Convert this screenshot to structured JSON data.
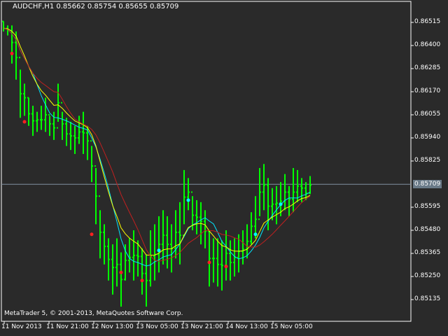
{
  "header": {
    "title": "AUDCHF,H1  0.85662 0.85754 0.85655 0.85709"
  },
  "footer": {
    "copyright": "MetaTrader 5, © 2001-2013, MetaQuotes Software Corp."
  },
  "colors": {
    "bg": "#2a2a2a",
    "bars": "#00ff00",
    "ma_fast": "#00e5ff",
    "ma_slow": "#ffff00",
    "ma_signal": "#c02020",
    "frame": "#ffffff",
    "price_line": "#8090a0"
  },
  "chart_data": {
    "type": "bar",
    "title": "AUDCHF,H1",
    "current_price": "0.85709",
    "ylim": [
      0.8502,
      0.8658
    ],
    "y_ticks": [
      "0.86515",
      "0.86400",
      "0.86285",
      "0.86170",
      "0.86055",
      "0.85940",
      "0.85825",
      "0.85595",
      "0.85480",
      "0.85365",
      "0.85250",
      "0.85135"
    ],
    "x_ticks": [
      "11 Nov 2013",
      "11 Nov 21:00",
      "12 Nov 13:00",
      "13 Nov 05:00",
      "13 Nov 21:00",
      "14 Nov 13:00",
      "15 Nov 05:00"
    ],
    "high": [
      0.8652,
      0.865,
      0.865,
      0.8647,
      0.8628,
      0.8621,
      0.8614,
      0.861,
      0.8607,
      0.861,
      0.8614,
      0.8605,
      0.8607,
      0.8621,
      0.8607,
      0.8604,
      0.8602,
      0.86,
      0.8605,
      0.8607,
      0.86,
      0.859,
      0.8579,
      0.8558,
      0.8551,
      0.8544,
      0.8541,
      0.8544,
      0.8537,
      0.8541,
      0.8544,
      0.8548,
      0.8543,
      0.8539,
      0.8536,
      0.8548,
      0.8551,
      0.8555,
      0.8558,
      0.8555,
      0.8551,
      0.8558,
      0.8562,
      0.8578,
      0.8574,
      0.8565,
      0.8563,
      0.8562,
      0.8558,
      0.8548,
      0.8544,
      0.8544,
      0.8543,
      0.8548,
      0.8543,
      0.8544,
      0.8546,
      0.8548,
      0.8551,
      0.8557,
      0.8565,
      0.8579,
      0.8581,
      0.8574,
      0.8569,
      0.857,
      0.8572,
      0.8576,
      0.857,
      0.8579,
      0.8578,
      0.8574,
      0.8572,
      0.8575
    ],
    "low": [
      0.8647,
      0.8645,
      0.8631,
      0.8623,
      0.8604,
      0.8605,
      0.86,
      0.8595,
      0.8597,
      0.8598,
      0.8597,
      0.8595,
      0.8593,
      0.8602,
      0.8593,
      0.859,
      0.8588,
      0.8586,
      0.8591,
      0.8586,
      0.8583,
      0.8572,
      0.8551,
      0.8534,
      0.8531,
      0.8523,
      0.8516,
      0.852,
      0.851,
      0.8523,
      0.8527,
      0.8523,
      0.8525,
      0.8516,
      0.851,
      0.852,
      0.8523,
      0.8527,
      0.8531,
      0.8529,
      0.8527,
      0.8534,
      0.8531,
      0.8551,
      0.8558,
      0.8548,
      0.8546,
      0.8541,
      0.8539,
      0.852,
      0.8522,
      0.852,
      0.8518,
      0.8523,
      0.8523,
      0.8525,
      0.8527,
      0.8531,
      0.8534,
      0.8541,
      0.8544,
      0.8555,
      0.8558,
      0.8548,
      0.8553,
      0.8551,
      0.8555,
      0.8558,
      0.8555,
      0.8557,
      0.8562,
      0.8562,
      0.8563,
      0.8566
    ],
    "signals": [
      {
        "bar": 2,
        "price": 0.8636,
        "color": "red"
      },
      {
        "bar": 5,
        "price": 0.8602,
        "color": "red"
      },
      {
        "bar": 21,
        "price": 0.8546,
        "color": "red"
      },
      {
        "bar": 28,
        "price": 0.8527,
        "color": "red"
      },
      {
        "bar": 33,
        "price": 0.8523,
        "color": "red"
      },
      {
        "bar": 37,
        "price": 0.8538,
        "color": "cyan"
      },
      {
        "bar": 44,
        "price": 0.8563,
        "color": "cyan"
      },
      {
        "bar": 49,
        "price": 0.8532,
        "color": "red"
      },
      {
        "bar": 53,
        "price": 0.853,
        "color": "red"
      },
      {
        "bar": 60,
        "price": 0.8546,
        "color": "cyan"
      },
      {
        "bar": 66,
        "price": 0.8561,
        "color": "cyan"
      }
    ]
  }
}
